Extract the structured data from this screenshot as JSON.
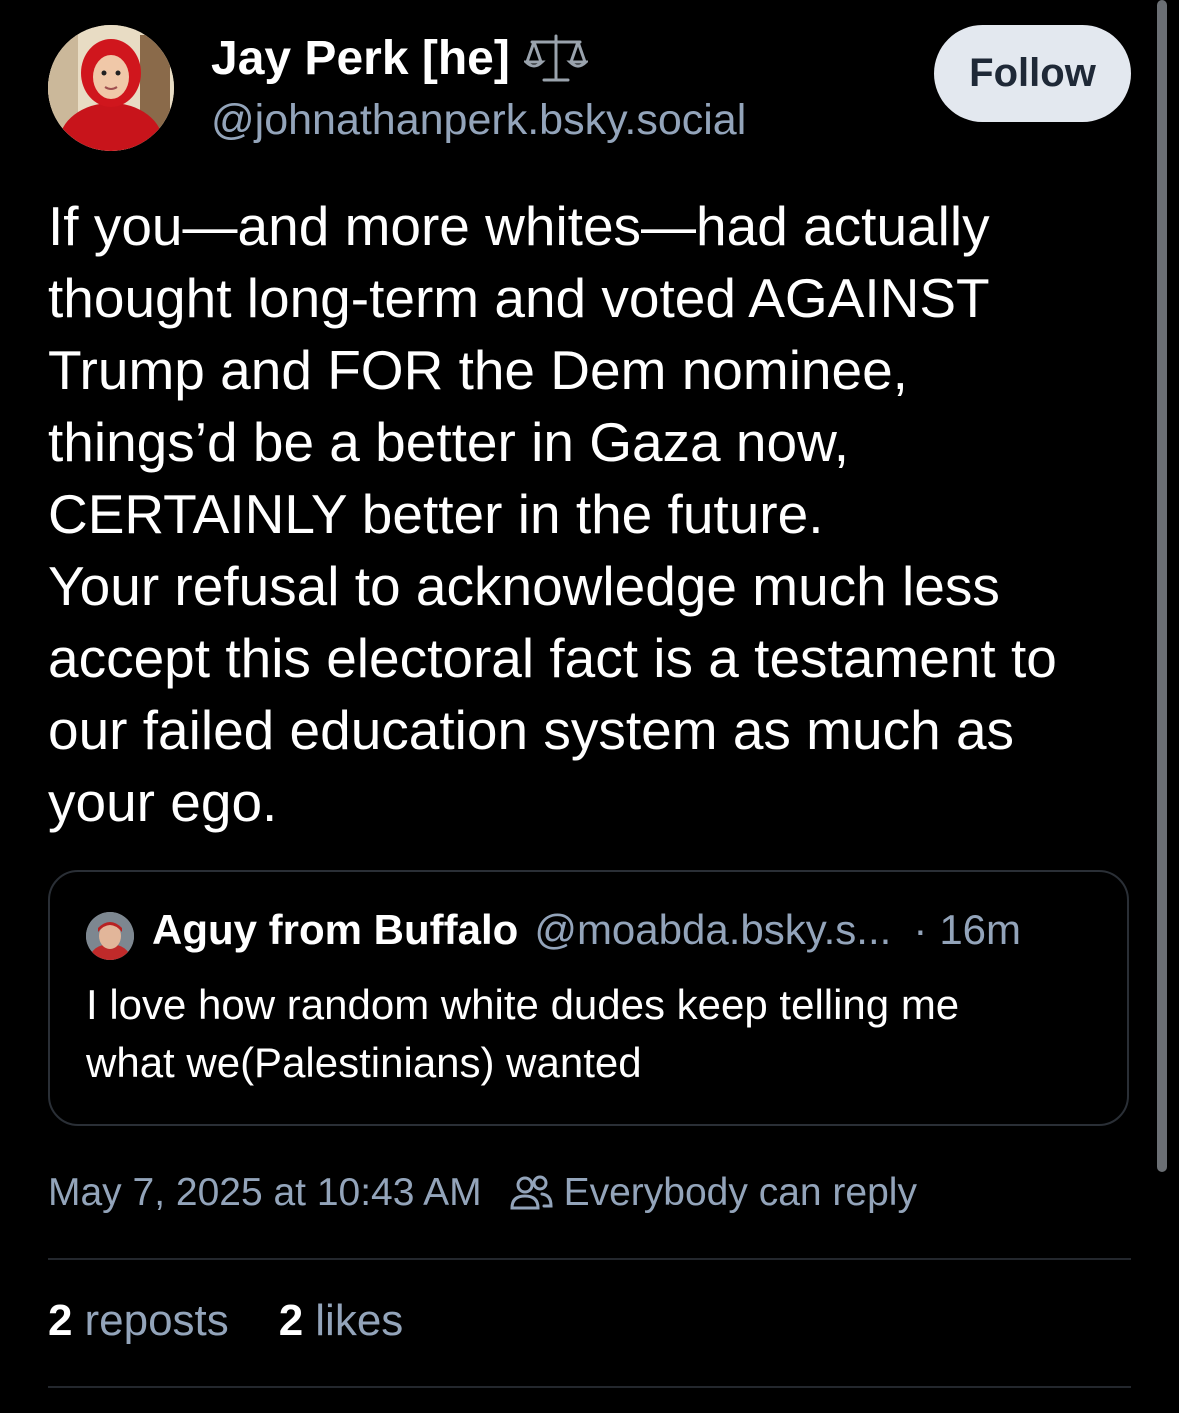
{
  "post": {
    "author": {
      "display_name": "Jay Perk [he]",
      "badge_icon": "balance-scale-icon",
      "handle": "@johnathanperk.bsky.social"
    },
    "follow_label": "Follow",
    "text_lines": [
      "If you—and more whites—had actually",
      "thought long-term and voted AGAINST",
      "Trump and FOR the Dem nominee,",
      "things’d be a better in Gaza now,",
      "CERTAINLY better in the future.",
      "Your refusal to acknowledge much less",
      "accept this electoral fact is a testament to",
      "our failed education system as much as",
      "your ego."
    ],
    "quote": {
      "author_name": "Aguy from Buffalo",
      "handle": "@moabda.bsky.s...",
      "separator": "·",
      "time": "16m",
      "text_lines": [
        "I love how random white dudes keep telling me",
        "what we(Palestinians) wanted"
      ]
    },
    "timestamp": "May 7, 2025 at 10:43 AM",
    "reply_setting": "Everybody can reply",
    "reply_setting_icon": "people-icon",
    "stats": {
      "reposts_count": "2",
      "reposts_label": "reposts",
      "likes_count": "2",
      "likes_label": "likes"
    }
  },
  "colors": {
    "background": "#000000",
    "text_primary": "#ffffff",
    "text_secondary": "#93a4ba",
    "follow_button_bg": "#e3e8ef",
    "border": "#2a2f36"
  }
}
